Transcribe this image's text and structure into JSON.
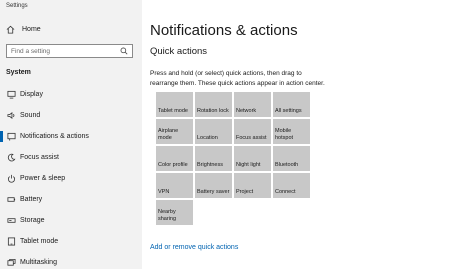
{
  "window": {
    "title": "Settings"
  },
  "sidebar": {
    "home_label": "Home",
    "search_placeholder": "Find a setting",
    "section_label": "System",
    "items": [
      {
        "label": "Display",
        "icon": "display-icon"
      },
      {
        "label": "Sound",
        "icon": "speaker-icon"
      },
      {
        "label": "Notifications & actions",
        "icon": "notification-icon",
        "active": true
      },
      {
        "label": "Focus assist",
        "icon": "moon-icon"
      },
      {
        "label": "Power & sleep",
        "icon": "power-icon"
      },
      {
        "label": "Battery",
        "icon": "battery-icon"
      },
      {
        "label": "Storage",
        "icon": "storage-icon"
      },
      {
        "label": "Tablet mode",
        "icon": "tablet-icon"
      },
      {
        "label": "Multitasking",
        "icon": "multitasking-icon"
      }
    ]
  },
  "main": {
    "title": "Notifications & actions",
    "subtitle": "Quick actions",
    "description": "Press and hold (or select) quick actions, then drag to rearrange them. These quick actions appear in action center.",
    "tiles": [
      "Tablet mode",
      "Rotation lock",
      "Network",
      "All settings",
      "Airplane mode",
      "Location",
      "Focus assist",
      "Mobile hotspot",
      "Color profile",
      "Brightness",
      "Night light",
      "Bluetooth",
      "VPN",
      "Battery saver",
      "Project",
      "Connect",
      "Nearby sharing"
    ],
    "link": "Add or remove quick actions"
  },
  "colors": {
    "accent": "#0063b1",
    "tile": "#c8c8c8",
    "sidebar_bg": "#f2f2f2"
  }
}
